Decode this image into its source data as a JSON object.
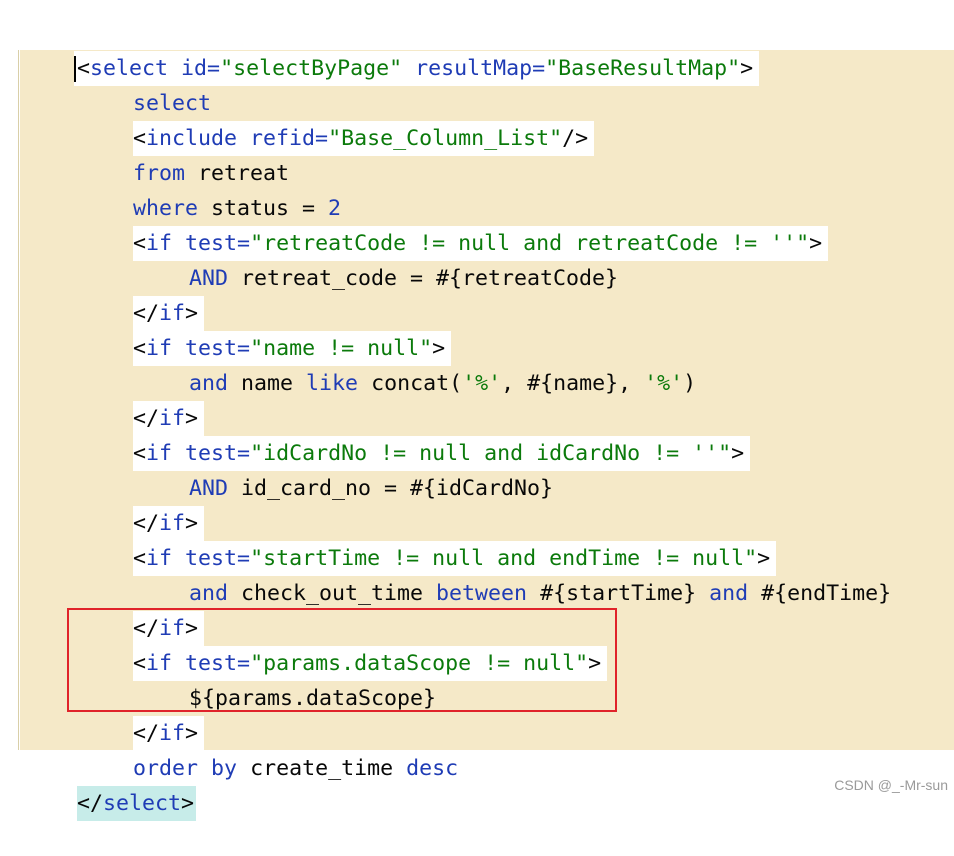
{
  "editor": {
    "l1": [
      "<",
      "select",
      " id=",
      "\"selectByPage\"",
      " resultMap=",
      "\"BaseResultMap\"",
      ">"
    ],
    "l2": "select",
    "l3": [
      "<",
      "include",
      " refid=",
      "\"Base_Column_List\"",
      "/>"
    ],
    "l4": [
      "from",
      " retreat"
    ],
    "l5": [
      "where",
      " status = ",
      "2"
    ],
    "l6": [
      "<",
      "if",
      " test=",
      "\"retreatCode != null and retreatCode != ''\"",
      ">"
    ],
    "l7": [
      "AND",
      " retreat_code = #{retreatCode}"
    ],
    "l8": [
      "</",
      "if",
      ">"
    ],
    "l9": [
      "<",
      "if",
      " test=",
      "\"name != null\"",
      ">"
    ],
    "l10": [
      "and",
      " name ",
      "like",
      " concat(",
      "'%'",
      ", #{name}, ",
      "'%'",
      ")"
    ],
    "l11": [
      "</",
      "if",
      ">"
    ],
    "l12": [
      "<",
      "if",
      " test=",
      "\"idCardNo != null and idCardNo != ''\"",
      ">"
    ],
    "l13": [
      "AND",
      " id_card_no = #{idCardNo}"
    ],
    "l14": [
      "</",
      "if",
      ">"
    ],
    "l15": [
      "<",
      "if",
      " test=",
      "\"startTime != null and endTime != null\"",
      ">"
    ],
    "l16": [
      "and",
      " check_out_time ",
      "between",
      " #{startTime} ",
      "and",
      " #{endTime}"
    ],
    "l17": [
      "</",
      "if",
      ">"
    ],
    "l18": [
      "<",
      "if",
      " test=",
      "\"params.dataScope != null\"",
      ">"
    ],
    "l19": "${params.dataScope}",
    "l20": [
      "</",
      "if",
      ">"
    ],
    "l21": [
      "order",
      " ",
      "by",
      " create_time ",
      "desc"
    ],
    "l22": [
      "</",
      "select",
      ">"
    ]
  },
  "colors": {
    "tag": "#1f3cb5",
    "string": "#0b7a0b",
    "text": "#080808",
    "background": "#f5e9c8",
    "highlight_box": "#e0232a"
  },
  "watermark": "CSDN @_-Mr-sun"
}
